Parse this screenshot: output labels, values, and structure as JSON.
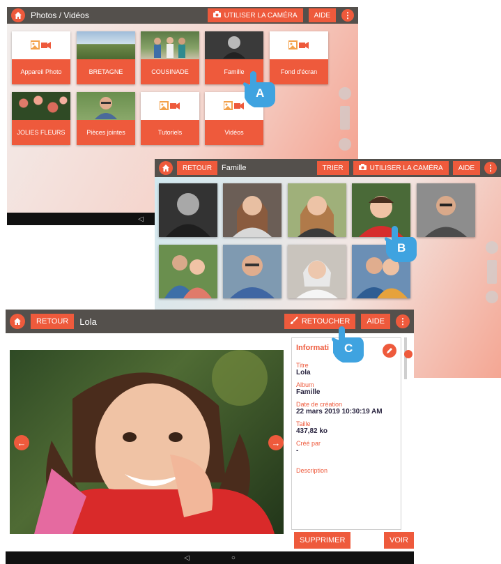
{
  "screen_a": {
    "title": "Photos / Vidéos",
    "camera_button": "UTILISER LA CAMÉRA",
    "help_button": "AIDE",
    "more_icon": "⋮",
    "albums": [
      {
        "label": "Appareil Photo",
        "thumb": "media-placeholder"
      },
      {
        "label": "BRETAGNE",
        "thumb": "landscape-photo"
      },
      {
        "label": "COUSINADE",
        "thumb": "group-photo"
      },
      {
        "label": "Famille",
        "thumb": "portrait-photo"
      },
      {
        "label": "Fond d'écran",
        "thumb": "media-placeholder"
      },
      {
        "label": "JOLIES FLEURS",
        "thumb": "flowers-photo"
      },
      {
        "label": "Pièces jointes",
        "thumb": "portrait-photo"
      },
      {
        "label": "Tutoriels",
        "thumb": "media-placeholder"
      },
      {
        "label": "Vidéos",
        "thumb": "media-placeholder"
      }
    ],
    "nav_back": "◁"
  },
  "screen_b": {
    "back_button": "RETOUR",
    "title": "Famille",
    "sort_button": "TRIER",
    "camera_button": "UTILISER LA CAMÉRA",
    "help_button": "AIDE",
    "more_icon": "⋮"
  },
  "screen_c": {
    "back_button": "RETOUR",
    "title": "Lola",
    "retouch_button": "RETOUCHER",
    "help_button": "AIDE",
    "more_icon": "⋮",
    "info_heading": "Informati",
    "fields": [
      {
        "label": "Titre",
        "value": "Lola"
      },
      {
        "label": "Album",
        "value": "Famille"
      },
      {
        "label": "Date de création",
        "value": "22 mars 2019 10:30:19 AM"
      },
      {
        "label": "Taille",
        "value": "437,82 ko"
      },
      {
        "label": "Créé par",
        "value": "-"
      },
      {
        "label": "Description",
        "value": ""
      }
    ],
    "delete_button": "SUPPRIMER",
    "view_button": "VOIR",
    "nav_back": "◁",
    "nav_home": "○"
  },
  "callouts": [
    "A",
    "B",
    "C"
  ],
  "colors": {
    "accent": "#ee5a3c",
    "topbar": "#54504c",
    "callout": "#3fa3e0",
    "navbar": "#111111"
  }
}
